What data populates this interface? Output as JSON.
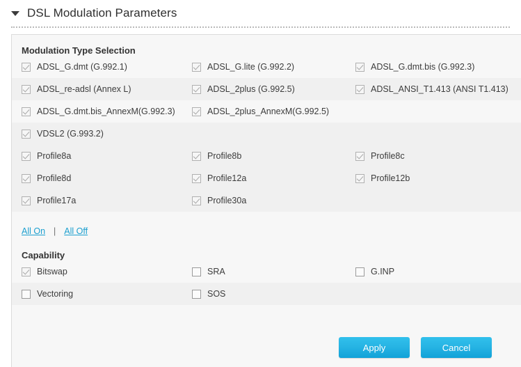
{
  "header": {
    "title": "DSL Modulation Parameters",
    "collapse_icon": "triangle-down-icon"
  },
  "sections": {
    "modulation": {
      "title": "Modulation Type Selection",
      "rows": [
        [
          {
            "label": "ADSL_G.dmt (G.992.1)",
            "checked": true
          },
          {
            "label": "ADSL_G.lite (G.992.2)",
            "checked": true
          },
          {
            "label": "ADSL_G.dmt.bis (G.992.3)",
            "checked": true
          }
        ],
        [
          {
            "label": "ADSL_re-adsl (Annex L)",
            "checked": true
          },
          {
            "label": "ADSL_2plus (G.992.5)",
            "checked": true
          },
          {
            "label": "ADSL_ANSI_T1.413 (ANSI T1.413)",
            "checked": true
          }
        ],
        [
          {
            "label": "ADSL_G.dmt.bis_AnnexM(G.992.3)",
            "checked": true
          },
          {
            "label": "ADSL_2plus_AnnexM(G.992.5)",
            "checked": true
          },
          {
            "label": "",
            "checked": false,
            "empty": true
          }
        ],
        [
          {
            "label": "VDSL2 (G.993.2)",
            "checked": true
          },
          {
            "label": "",
            "checked": false,
            "empty": true
          },
          {
            "label": "",
            "checked": false,
            "empty": true
          }
        ]
      ]
    },
    "profiles": {
      "rows": [
        [
          {
            "label": "Profile8a",
            "checked": true
          },
          {
            "label": "Profile8b",
            "checked": true
          },
          {
            "label": "Profile8c",
            "checked": true
          }
        ],
        [
          {
            "label": "Profile8d",
            "checked": true
          },
          {
            "label": "Profile12a",
            "checked": true
          },
          {
            "label": "Profile12b",
            "checked": true
          }
        ],
        [
          {
            "label": "Profile17a",
            "checked": true
          },
          {
            "label": "Profile30a",
            "checked": true
          },
          {
            "label": "",
            "checked": false,
            "empty": true
          }
        ]
      ]
    },
    "links": {
      "all_on": "All On",
      "separator": "|",
      "all_off": "All Off"
    },
    "capability": {
      "title": "Capability",
      "rows": [
        [
          {
            "label": "Bitswap",
            "checked": true
          },
          {
            "label": "SRA",
            "checked": false
          },
          {
            "label": "G.INP",
            "checked": false
          }
        ],
        [
          {
            "label": "Vectoring",
            "checked": false
          },
          {
            "label": "SOS",
            "checked": false
          },
          {
            "label": "",
            "checked": false,
            "empty": true
          }
        ]
      ]
    }
  },
  "footer": {
    "apply_label": "Apply",
    "cancel_label": "Cancel"
  },
  "colors": {
    "accent": "#1b9fcf",
    "button": "#27b4e4",
    "panel_bg": "#f7f7f7",
    "shaded_row": "#f0f0f0"
  }
}
